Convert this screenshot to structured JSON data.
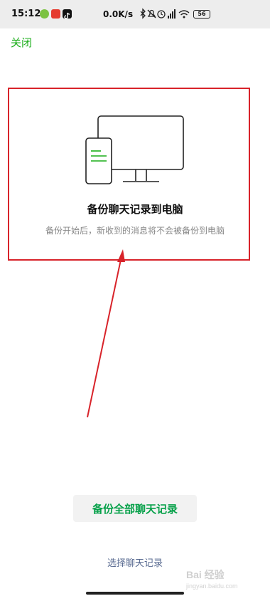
{
  "status_bar": {
    "time": "15:12",
    "network_speed": "0.0K/s",
    "battery_level": "56",
    "icons": [
      "app-green-icon",
      "app-red-icon",
      "tiktok-icon",
      "bluetooth-icon",
      "mute-icon",
      "alarm-icon",
      "signal-icon",
      "wifi-icon",
      "battery-icon"
    ]
  },
  "header": {
    "close_label": "关闭"
  },
  "main": {
    "illustration": "monitor-and-phone-icon",
    "title": "备份聊天记录到电脑",
    "subtitle": "备份开始后，新收到的消息将不会被备份到电脑"
  },
  "actions": {
    "backup_all_label": "备份全部聊天记录",
    "select_label": "选择聊天记录"
  },
  "watermark": {
    "text": "Bai 经验",
    "sub": "jingyan.baidu.com"
  },
  "colors": {
    "accent_green": "#07a14a",
    "annotation_red": "#d8232a",
    "link_blue": "#56688f"
  }
}
